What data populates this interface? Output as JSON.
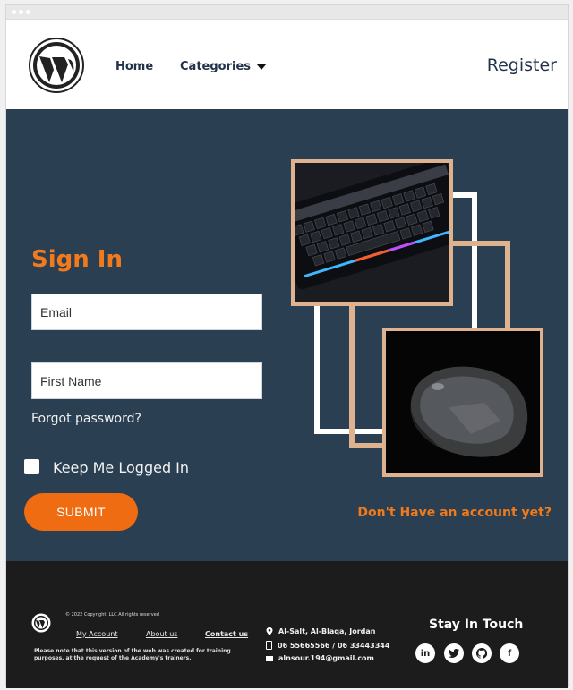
{
  "header": {
    "nav_home": "Home",
    "nav_categories": "Categories",
    "register": "Register"
  },
  "signin": {
    "title": "Sign In",
    "email_placeholder": "Email",
    "firstname_placeholder": "First Name",
    "forgot": "Forgot password?",
    "keep_logged_in": "Keep Me Logged In",
    "submit": "SUBMIT",
    "no_account": "Don't Have an account yet?"
  },
  "footer": {
    "copyright": "© 2022 Copyright: LLC All rights reserved",
    "links": [
      "My Account",
      "About us",
      "Contact us"
    ],
    "note": "Please note that this version of the web was created for training purposes, at the request of the Academy's trainers.",
    "address": "Al-Salt, Al-Blaqa, Jordan",
    "phones": "06 55665566  /  06 33443344",
    "email": "alnsour.194@gmail.com",
    "stay_in_touch": "Stay In Touch"
  },
  "colors": {
    "accent": "#f07a1c",
    "hero_bg": "#2a3f52",
    "frame_tan": "#deb28f",
    "footer_bg": "#1c1c1c"
  }
}
